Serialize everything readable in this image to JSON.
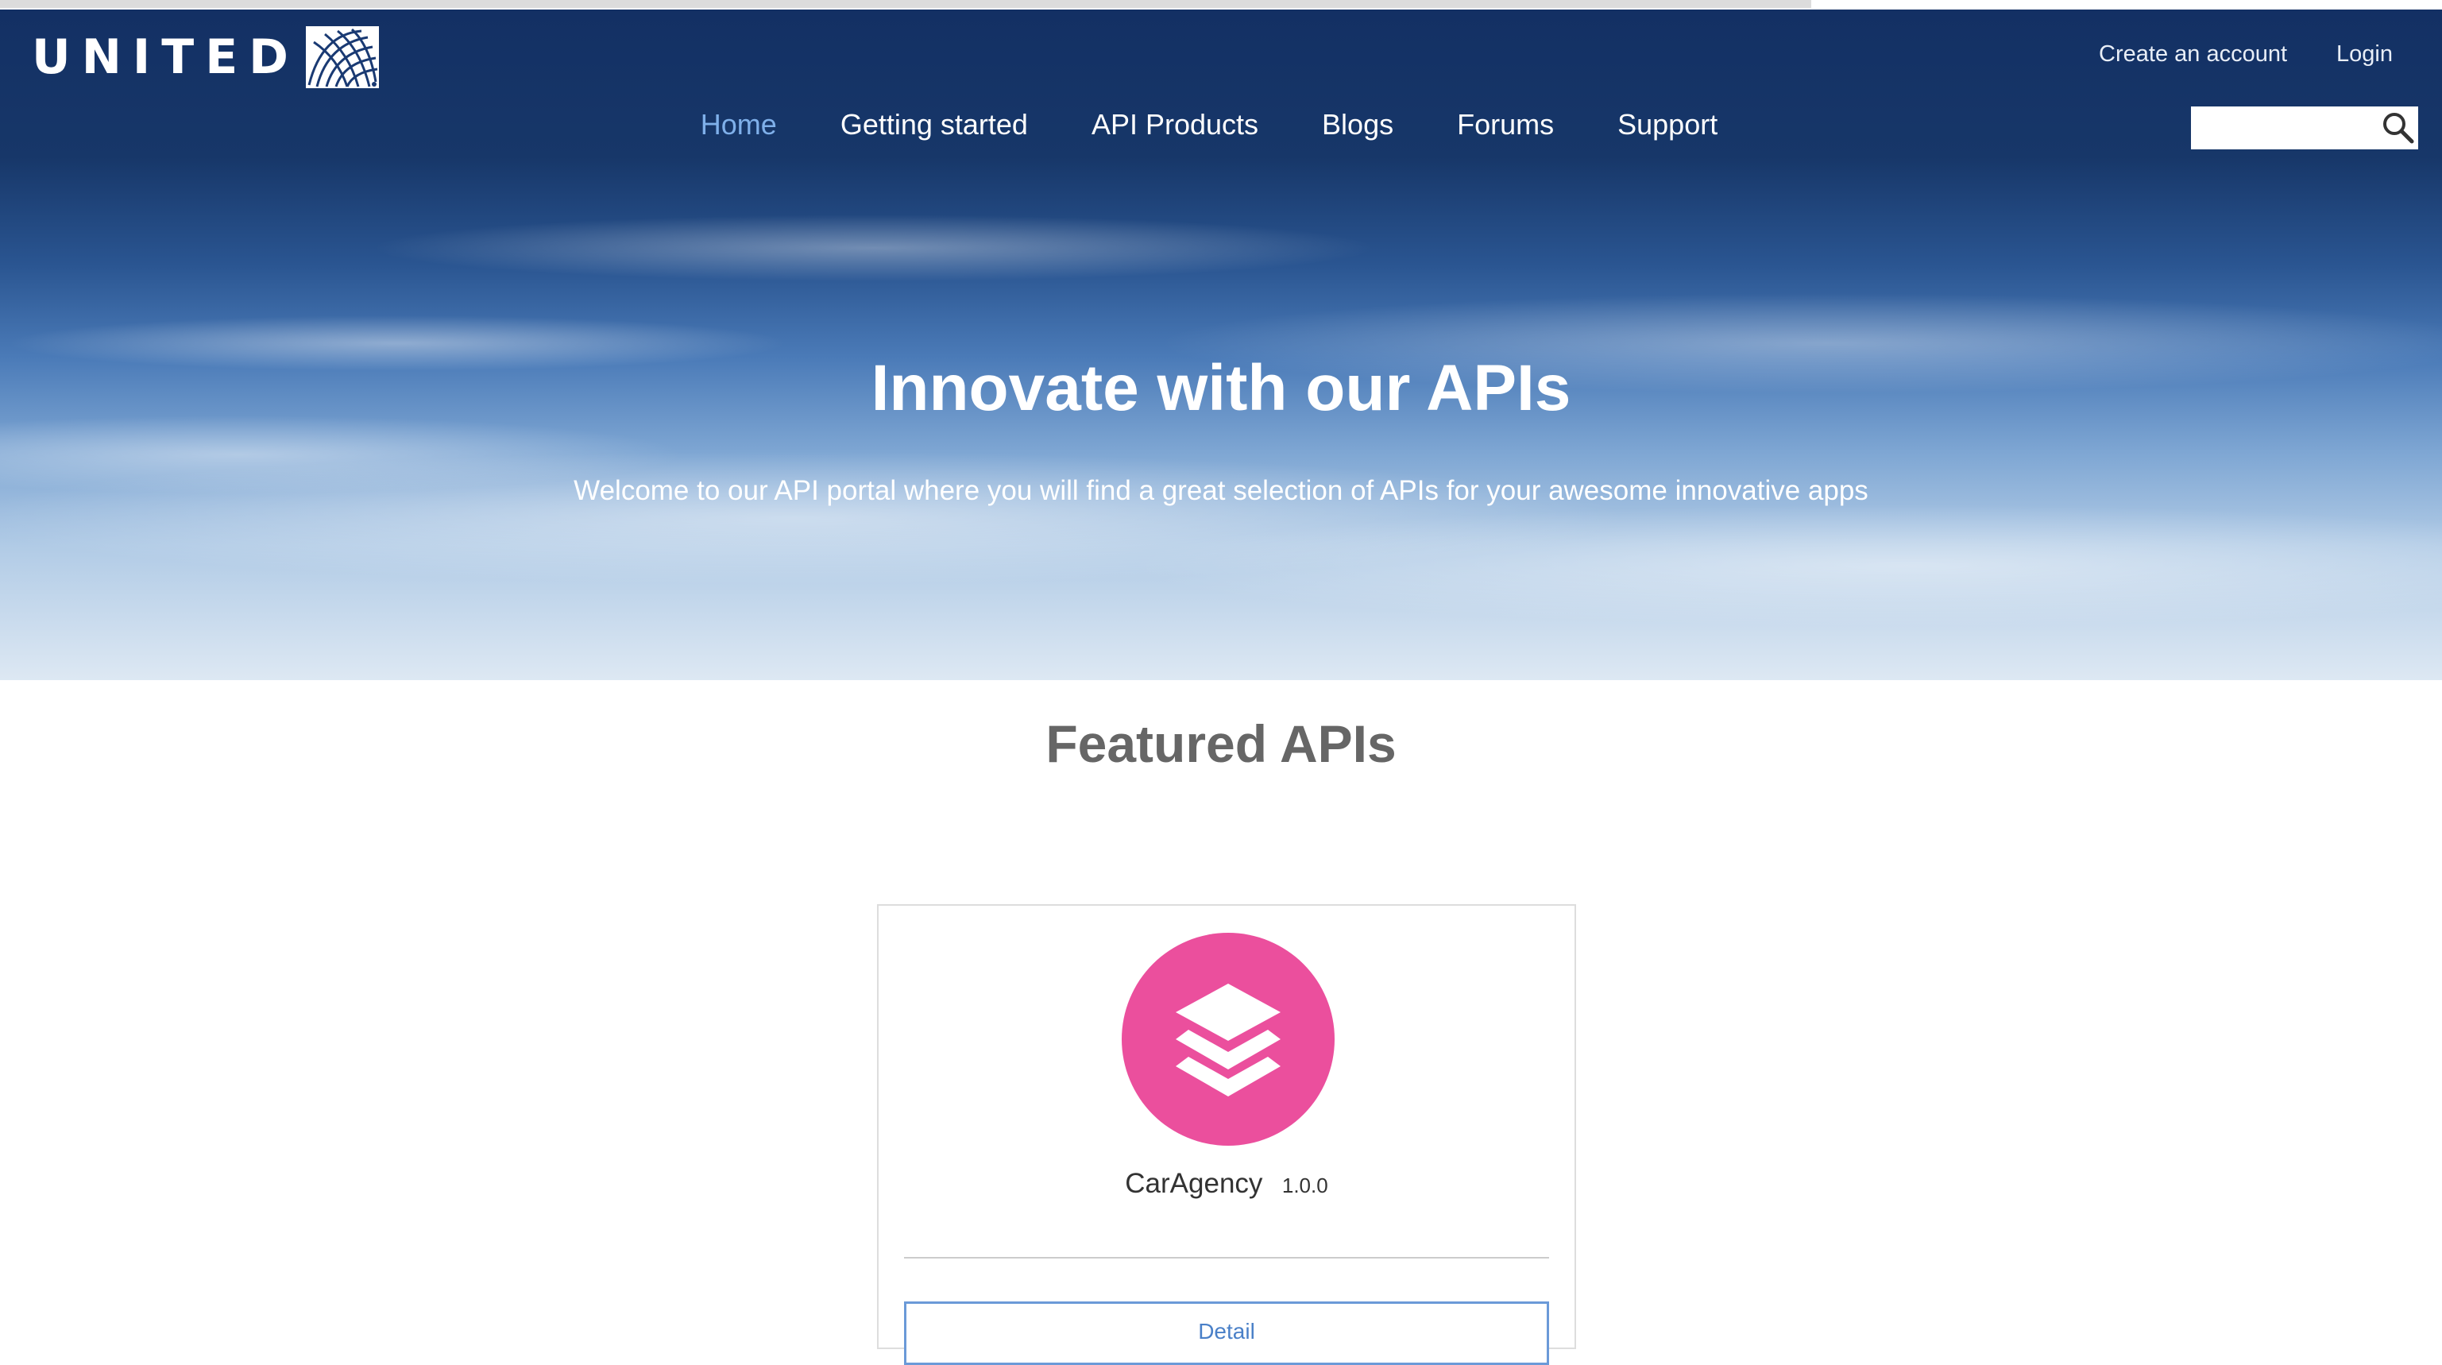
{
  "header": {
    "logo_text": "UNITED",
    "account_links": {
      "create_account": "Create an account",
      "login": "Login"
    },
    "nav": [
      {
        "label": "Home",
        "active": true
      },
      {
        "label": "Getting started",
        "active": false
      },
      {
        "label": "API Products",
        "active": false
      },
      {
        "label": "Blogs",
        "active": false
      },
      {
        "label": "Forums",
        "active": false
      },
      {
        "label": "Support",
        "active": false
      }
    ],
    "search": {
      "value": "",
      "placeholder": ""
    }
  },
  "hero": {
    "title": "Innovate with our APIs",
    "subtitle": "Welcome to our API portal where you will find a great selection of APIs for your awesome innovative apps"
  },
  "featured": {
    "title": "Featured APIs",
    "apis": [
      {
        "name": "CarAgency",
        "version": "1.0.0",
        "icon": "layers-icon",
        "icon_color": "#eb4f9d",
        "detail_label": "Detail"
      }
    ]
  },
  "colors": {
    "nav_active": "#7fb0ea",
    "header_bg": "#133064",
    "detail_button_border": "#6b9ad8"
  }
}
